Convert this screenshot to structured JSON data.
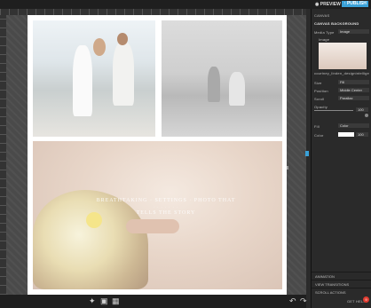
{
  "header": {
    "preview_label": "PREVIEW",
    "publish_label": "PUBLISH",
    "preview_icon": "eye-icon",
    "publish_icon": "upload-icon"
  },
  "canvas": {
    "overlay_line1": "BREATHTAKING  ·  SETTINGS  ·  PHOTO  THAT",
    "overlay_line2": "·  ·  ·  ·  ·  ·  ·",
    "overlay_line3": "TELLS  THE  STORY"
  },
  "toolbar": {
    "icons": [
      "magic-icon",
      "layout-icon",
      "image-icon"
    ],
    "undo_icon": "undo-icon",
    "redo_icon": "redo-icon"
  },
  "panel": {
    "section_header": "CANVAS",
    "title": "CANVAS BACKGROUND",
    "media_type_label": "Media Type",
    "media_type_value": "Image",
    "image_label": "Image",
    "image_filename": "courtney_linden_designintelligence_...",
    "fill_label": "Size",
    "fill_value": "Fill",
    "position_label": "Position",
    "position_value": "Middle Center",
    "scroll_label": "Scroll",
    "scroll_value": "Parallax",
    "opacity_label": "Opacity",
    "opacity_value": "100",
    "fill2_label": "Fill",
    "fill2_value": "Color",
    "color_label": "Color",
    "color_value": "100",
    "color_swatch": "#ffffff",
    "sections": [
      "ANIMATION",
      "VIEW TRANSITIONS",
      "SCROLL ACTIONS"
    ],
    "get_help_label": "GET HELP",
    "badge_count": "9"
  },
  "colors": {
    "accent": "#3aa1d8",
    "badge": "#e03c31"
  }
}
